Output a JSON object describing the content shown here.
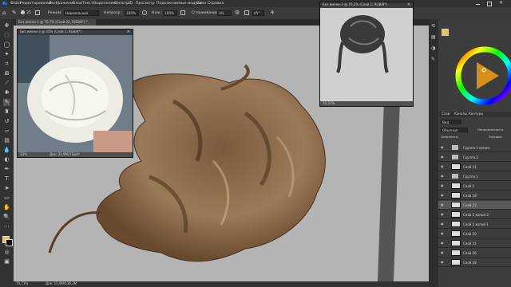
{
  "menu": [
    "Файл",
    "Редактирование",
    "Изображение",
    "Слои",
    "Текст",
    "Выделение",
    "Фильтр",
    "3D",
    "Просмотр",
    "Подключаемые модули",
    "Окно",
    "Справка"
  ],
  "options": {
    "brush_size": "35",
    "mode_label": "Режим:",
    "mode_value": "Нормальный",
    "opacity_label": "Непрозр.:",
    "opacity_value": "100%",
    "flow_label": "Наж.:",
    "flow_value": "100%",
    "smooth_label": "Сглаживание:",
    "smooth_value": "3%",
    "angle_value": "45°"
  },
  "document": {
    "tab_title": "Без имени-1 @ 70,7% (Слой 22, RGB/8*) *",
    "zoom": "70,71%",
    "status": "Док: 15,9М/136,2М"
  },
  "ref_window_left": {
    "title": "Без имени-2 @ 35% (Слой 1, RGB/8*)",
    "zoom": "33%",
    "status": "Док: 31,9М/3 Байт"
  },
  "ref_window_right": {
    "title": "Без имени-3 @ 70,2% (Слой 1, RGB/8*)",
    "zoom": "70,23%"
  },
  "panels": {
    "tabs": [
      "Слои",
      "Каналы",
      "Контуры"
    ],
    "filter_label": "Вид",
    "blend_mode": "Обычные",
    "opacity_label": "Непрозрачность",
    "lock_label": "Закрепить:",
    "fill_label": "Заливка"
  },
  "layers": [
    "Группа 2 копия",
    "Группа 2",
    "Слой 11",
    "Группа 1",
    "Слой 1",
    "Слой 18",
    "Слой 22",
    "Слой 2 копия 3",
    "Слой 2 копия 1",
    "Слой 20",
    "Слой 21",
    "Слой 26",
    "Слой 28"
  ],
  "colors": {
    "hair": "#8a6a4a",
    "canvas": "#b4b4b4",
    "panel": "#3d3d3d"
  }
}
